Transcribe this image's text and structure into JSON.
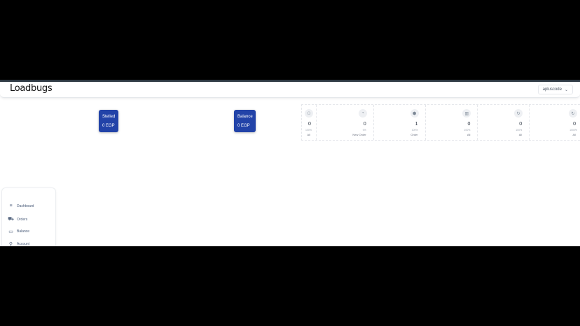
{
  "header": {
    "logo": "Loadbugs",
    "user": "apluscode"
  },
  "cards": [
    {
      "title": "Stelled",
      "value": "0 EGP"
    },
    {
      "title": "Balance",
      "value": "0 EGP"
    }
  ],
  "stats": [
    {
      "icon": "users-icon",
      "value": "0",
      "percent": "100%",
      "label": "All"
    },
    {
      "icon": "bell-icon",
      "value": "0",
      "percent": "0%",
      "label": "New Order"
    },
    {
      "icon": "box-icon",
      "value": "1",
      "percent": "100%",
      "label": "Order"
    },
    {
      "icon": "chart-icon",
      "value": "0",
      "percent": "100%",
      "label": "All"
    },
    {
      "icon": "refresh-icon",
      "value": "0",
      "percent": "100%",
      "label": "All"
    },
    {
      "icon": "refresh-icon",
      "value": "0",
      "percent": "1000%",
      "label": "All"
    }
  ],
  "sidebar": {
    "items": [
      {
        "icon": "menu-icon",
        "label": "Dashboard"
      },
      {
        "icon": "truck-icon",
        "label": "Orders"
      },
      {
        "icon": "card-icon",
        "label": "Balance"
      },
      {
        "icon": "user-icon",
        "label": "Account"
      }
    ]
  }
}
